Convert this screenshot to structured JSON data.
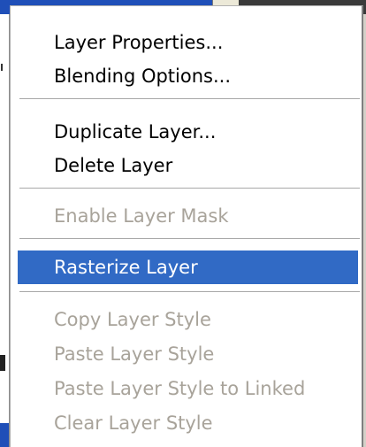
{
  "menu": {
    "items": [
      {
        "label": "Layer Properties...",
        "enabled": true
      },
      {
        "label": "Blending Options...",
        "enabled": true
      },
      {
        "label": "Duplicate Layer...",
        "enabled": true
      },
      {
        "label": "Delete Layer",
        "enabled": true
      },
      {
        "label": "Enable Layer Mask",
        "enabled": false
      },
      {
        "label": "Rasterize Layer",
        "enabled": true,
        "highlighted": true
      },
      {
        "label": "Copy Layer Style",
        "enabled": false
      },
      {
        "label": "Paste Layer Style",
        "enabled": false
      },
      {
        "label": "Paste Layer Style to Linked",
        "enabled": false
      },
      {
        "label": "Clear Layer Style",
        "enabled": false
      }
    ]
  },
  "colors": {
    "highlight": "#316ac5",
    "disabled_text": "#a8a39a",
    "menu_background": "#ffffff",
    "window_titlebar": "#1f4fb8"
  }
}
